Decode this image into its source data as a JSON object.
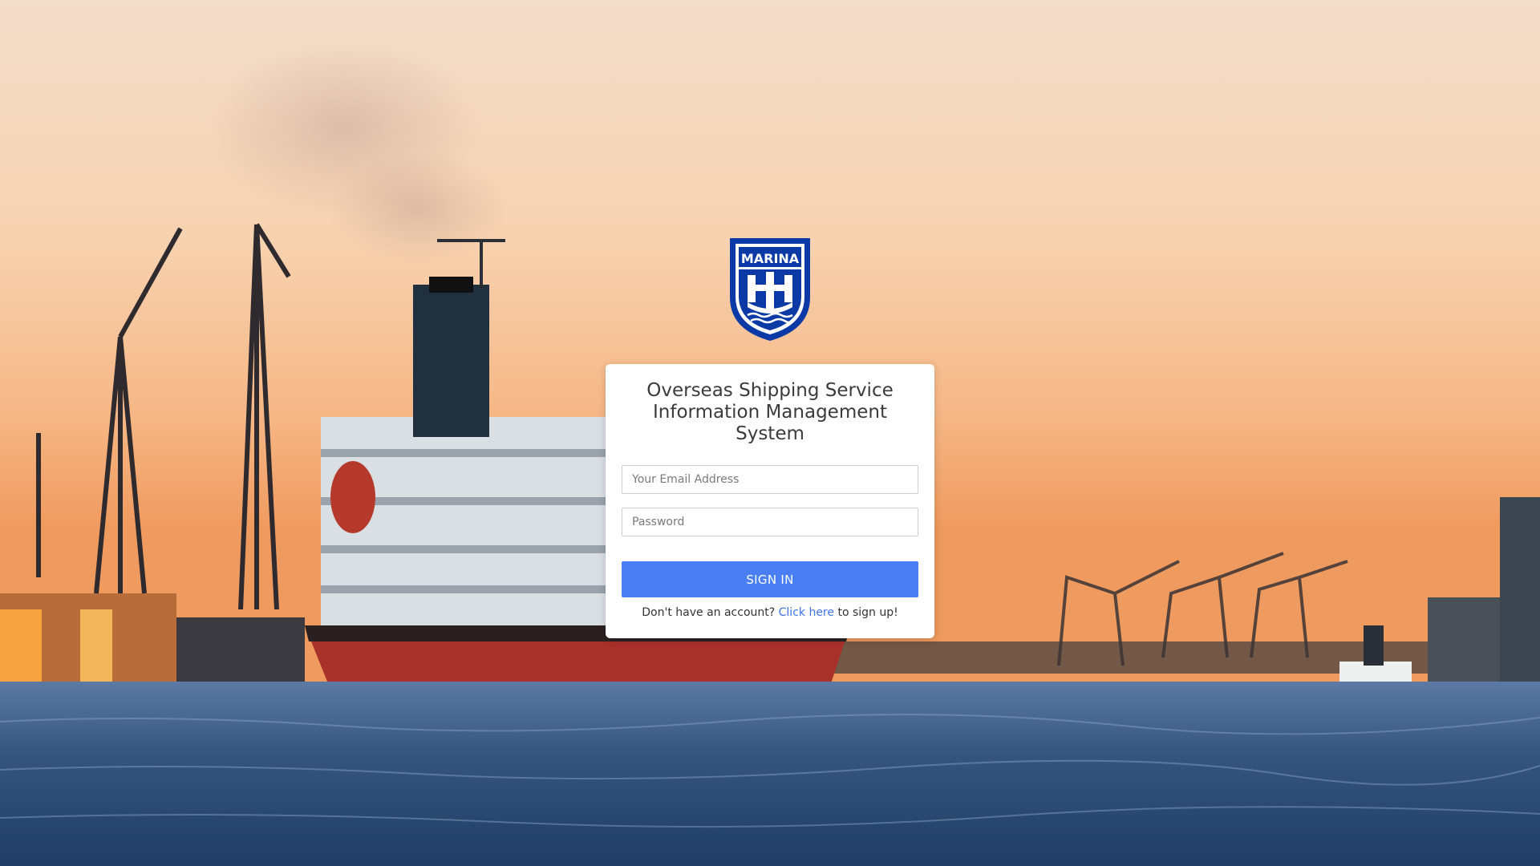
{
  "logo": {
    "text": "MARINA",
    "color": "#0b3aa6"
  },
  "login": {
    "title": "Overseas Shipping Service Information Management System",
    "email_placeholder": "Your Email Address",
    "password_placeholder": "Password",
    "signin_label": "SIGN IN",
    "signup_prefix": "Don't have an account?",
    "signup_link": "Click here",
    "signup_suffix": "to sign up!"
  },
  "colors": {
    "button": "#4a7ef5",
    "link": "#3f73e8"
  }
}
